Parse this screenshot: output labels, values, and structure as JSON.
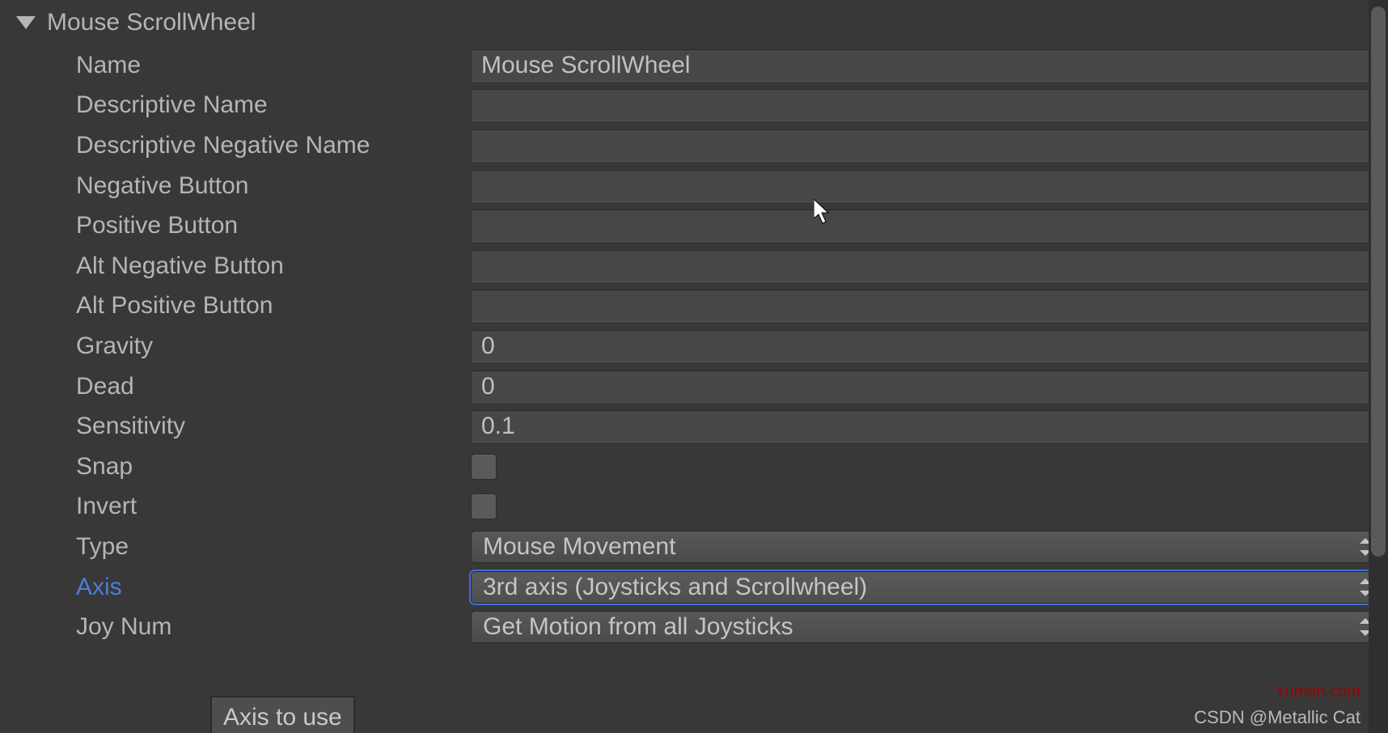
{
  "header": {
    "title": "Mouse ScrollWheel"
  },
  "fields": {
    "name": {
      "label": "Name",
      "value": "Mouse ScrollWheel"
    },
    "descName": {
      "label": "Descriptive Name",
      "value": ""
    },
    "descNegName": {
      "label": "Descriptive Negative Name",
      "value": ""
    },
    "negButton": {
      "label": "Negative Button",
      "value": ""
    },
    "posButton": {
      "label": "Positive Button",
      "value": ""
    },
    "altNegButton": {
      "label": "Alt Negative Button",
      "value": ""
    },
    "altPosButton": {
      "label": "Alt Positive Button",
      "value": ""
    },
    "gravity": {
      "label": "Gravity",
      "value": "0"
    },
    "dead": {
      "label": "Dead",
      "value": "0"
    },
    "sensitivity": {
      "label": "Sensitivity",
      "value": "0.1"
    },
    "snap": {
      "label": "Snap",
      "checked": false
    },
    "invert": {
      "label": "Invert",
      "checked": false
    },
    "type": {
      "label": "Type",
      "value": "Mouse Movement"
    },
    "axis": {
      "label": "Axis",
      "value": "3rd axis (Joysticks and Scrollwheel)"
    },
    "joyNum": {
      "label": "Joy Num",
      "value": "Get Motion from all Joysticks"
    }
  },
  "tooltip": {
    "text": "Axis to use"
  },
  "watermarks": {
    "top": "Yumen.com",
    "bottom": "CSDN @Metallic Cat"
  }
}
